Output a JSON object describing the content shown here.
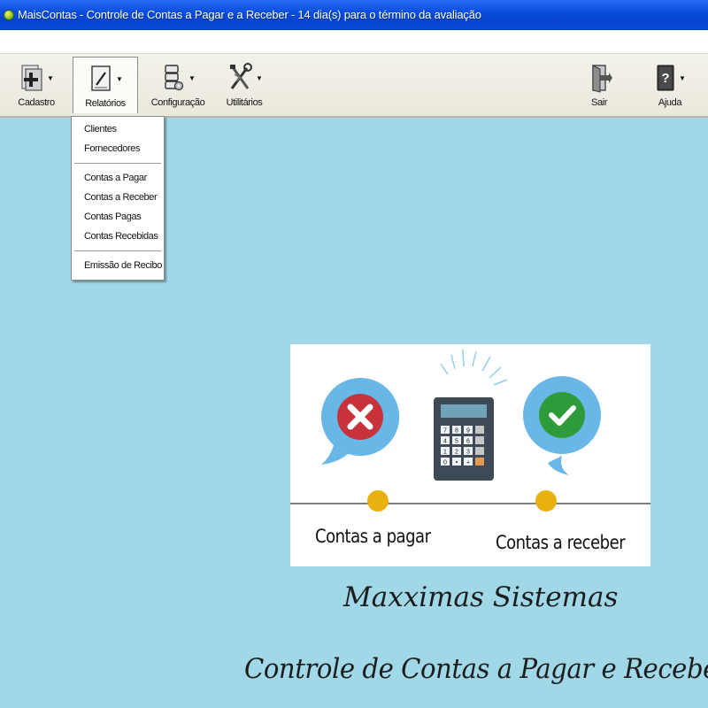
{
  "window": {
    "title": "MaisContas - Controle de Contas a Pagar e a Receber - 14 dia(s) para o término da avaliação",
    "app_icon": "app-globe-icon"
  },
  "toolbar": {
    "items": [
      {
        "label": "Cadastro",
        "icon": "add-document-icon"
      },
      {
        "label": "Relatórios",
        "icon": "report-icon",
        "active": true
      },
      {
        "label": "Configuração",
        "icon": "config-icon"
      },
      {
        "label": "Utilitários",
        "icon": "tools-icon"
      },
      {
        "label": "Sair",
        "icon": "exit-door-icon"
      },
      {
        "label": "Ajuda",
        "icon": "help-book-icon"
      }
    ]
  },
  "dropdown": {
    "groups": [
      [
        "Clientes",
        "Fornecedores"
      ],
      [
        "Contas a Pagar",
        "Contas a Receber",
        "Contas Pagas",
        "Contas Recebidas"
      ],
      [
        "Emissão de Recibo"
      ]
    ]
  },
  "promo": {
    "pay_label": "Contas a pagar",
    "receive_label": "Contas a receber",
    "calculator_keys": [
      "7",
      "8",
      "9",
      "",
      "4",
      "5",
      "6",
      "",
      "1",
      "2",
      "3",
      "",
      "0",
      "•",
      "+",
      ""
    ]
  },
  "footer": {
    "brand": "Maxximas Sistemas",
    "product": "Controle de Contas a Pagar e Receber"
  },
  "colors": {
    "desktop_bg": "#a0d8e8",
    "titlebar": "#0a4fe0",
    "reject_red": "#c8323a",
    "approve_green": "#2e9b3a",
    "bubble_blue": "#68b7e6",
    "dot_yellow": "#e8b10f"
  }
}
